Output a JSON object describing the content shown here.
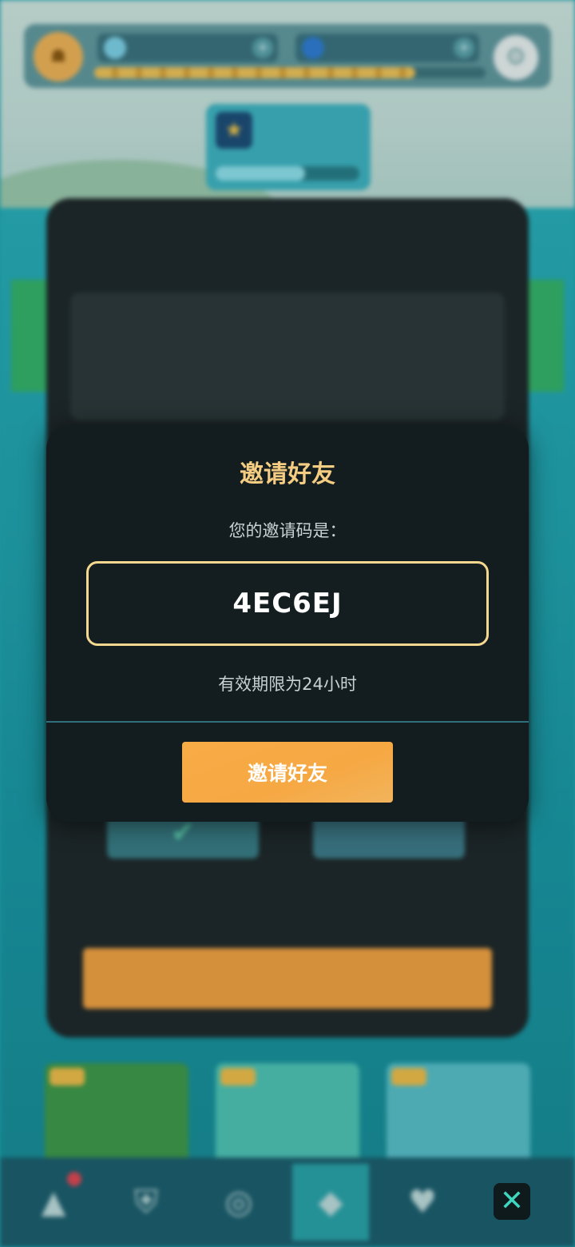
{
  "background": {
    "blurred": true,
    "topbar": {
      "avatar_icon": "coin-icon",
      "resource_1_icon": "water-drop-icon",
      "resource_2_icon": "cloud-icon",
      "settings_icon": "gear-icon"
    },
    "quest_card": {
      "icon": "star-badge-icon"
    },
    "bottom_nav": {
      "items": [
        "warning-triangle-icon",
        "shield-icon",
        "compass-icon",
        "diamond-icon",
        "heart-icon"
      ]
    }
  },
  "modal": {
    "title": "邀请好友",
    "code_label": "您的邀请码是：",
    "invite_code": "4EC6EJ",
    "validity_text": "有效期限为24小时",
    "invite_button_label": "邀请好友"
  },
  "close_button_label": "✕",
  "colors": {
    "modal_bg": "#131c1f",
    "title_gold": "#f4cd83",
    "code_border": "#f5d88f",
    "button_orange": "#f6a843",
    "divider_teal": "#2f6f7c",
    "close_icon_teal": "#3fd6bf"
  }
}
